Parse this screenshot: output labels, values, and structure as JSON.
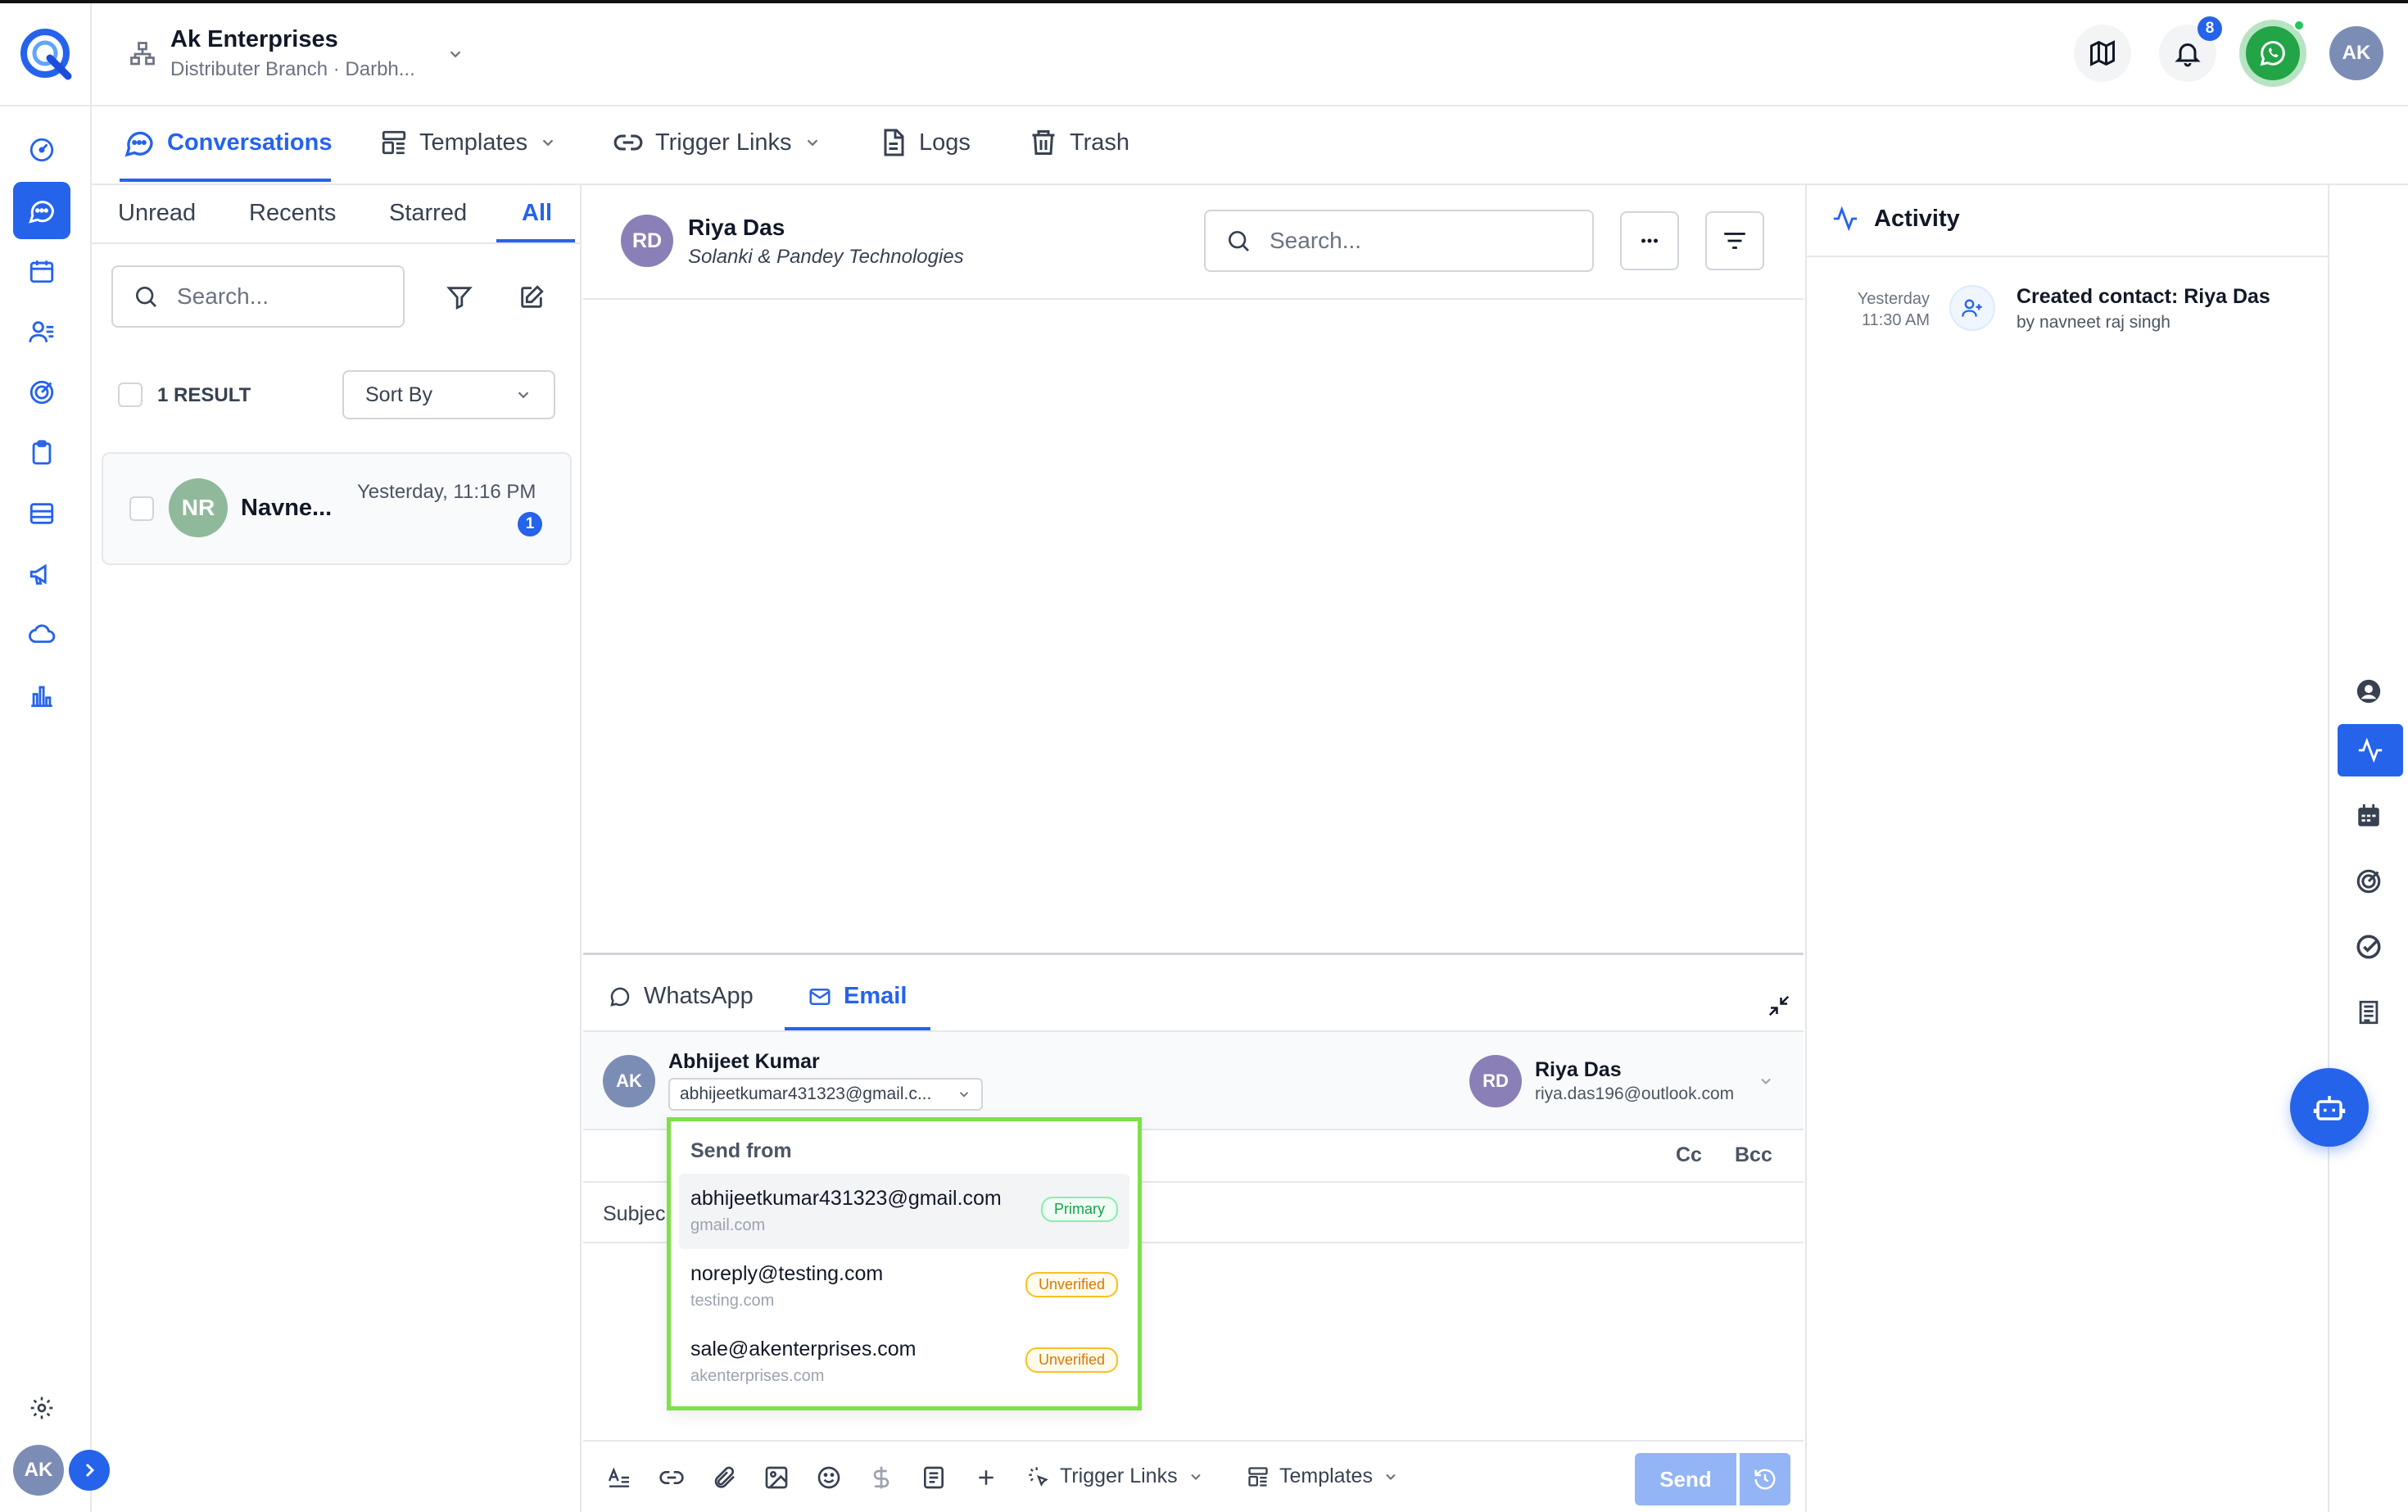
{
  "header": {
    "company_name": "Ak Enterprises",
    "company_sub": "Distributer Branch · Darbh...",
    "notification_count": "8",
    "user_initials": "AK"
  },
  "nav": {
    "tabs": [
      {
        "label": "Conversations"
      },
      {
        "label": "Templates"
      },
      {
        "label": "Trigger Links"
      },
      {
        "label": "Logs"
      },
      {
        "label": "Trash"
      }
    ]
  },
  "list": {
    "filters": [
      "Unread",
      "Recents",
      "Starred",
      "All"
    ],
    "search_placeholder": "Search...",
    "result_count": "1 RESULT",
    "sort_label": "Sort By",
    "conversations": [
      {
        "initials": "NR",
        "name": "Navne...",
        "time": "Yesterday, 11:16 PM",
        "unread": "1"
      }
    ]
  },
  "chat": {
    "contact_initials": "RD",
    "contact_name": "Riya Das",
    "contact_company": "Solanki & Pandey Technologies",
    "search_placeholder": "Search..."
  },
  "composer": {
    "tabs": [
      {
        "label": "WhatsApp"
      },
      {
        "label": "Email"
      }
    ],
    "from_initials": "AK",
    "from_name": "Abhijeet Kumar",
    "from_email": "abhijeetkumar431323@gmail.c...",
    "to_initials": "RD",
    "to_name": "Riya Das",
    "to_email": "riya.das196@outlook.com",
    "cc_label": "Cc",
    "bcc_label": "Bcc",
    "subject_label": "Subjec",
    "trigger_links_label": "Trigger Links",
    "templates_label": "Templates",
    "send_label": "Send"
  },
  "send_from": {
    "title": "Send from",
    "options": [
      {
        "email": "abhijeetkumar431323@gmail.com",
        "domain": "gmail.com",
        "badge": "Primary"
      },
      {
        "email": "noreply@testing.com",
        "domain": "testing.com",
        "badge": "Unverified"
      },
      {
        "email": "sale@akenterprises.com",
        "domain": "akenterprises.com",
        "badge": "Unverified"
      }
    ]
  },
  "activity": {
    "title": "Activity",
    "items": [
      {
        "day": "Yesterday",
        "time": "11:30 AM",
        "text": "Created contact: Riya Das",
        "by": "by navneet raj singh"
      }
    ]
  },
  "footer": {
    "user_initials": "AK"
  },
  "colors": {
    "accent": "#2563eb",
    "highlight_border": "#7ee04a",
    "whatsapp": "#22a447",
    "send_disabled": "#93b4f5"
  }
}
